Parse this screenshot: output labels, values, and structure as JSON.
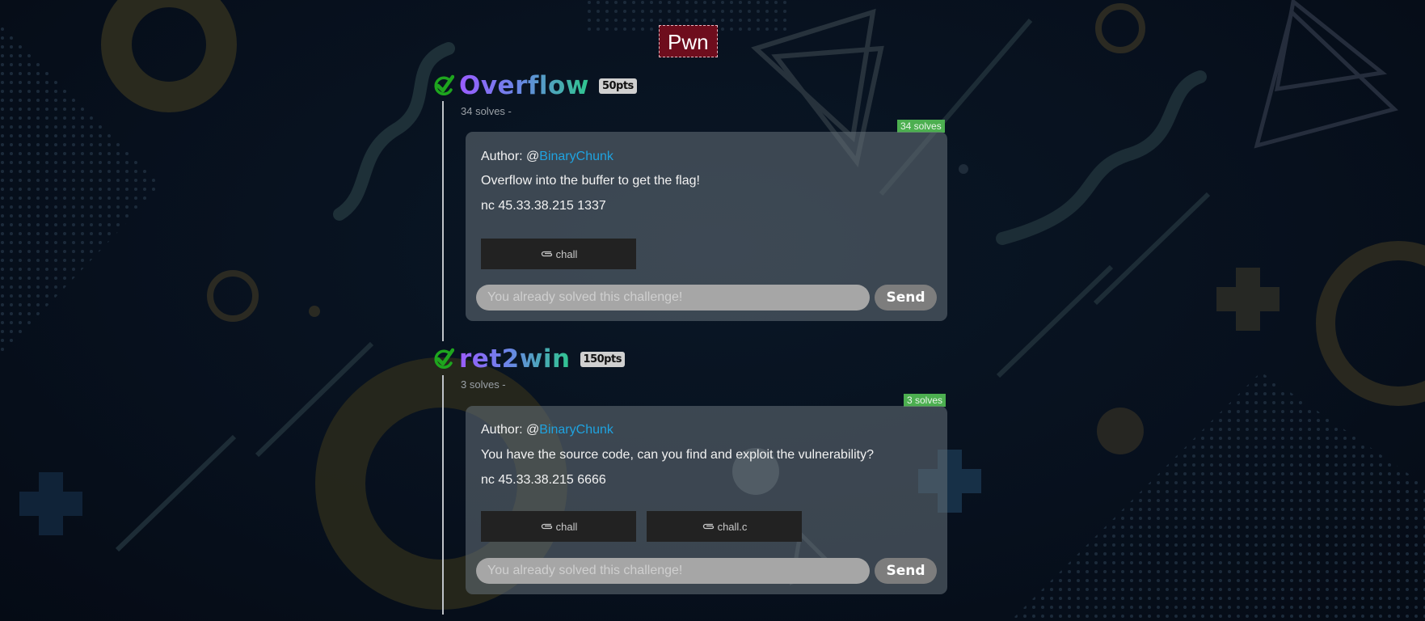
{
  "category": {
    "label": "Pwn"
  },
  "challenges": [
    {
      "title": "Overflow",
      "points": "50pts",
      "solves_line": "34 solves -",
      "solves_tag": "34 solves",
      "author_prefix": "Author: @",
      "author": "BinaryChunk",
      "description": "Overflow into the buffer to get the flag!",
      "connection": "nc 45.33.38.215 1337",
      "files": [
        "chall"
      ],
      "flag_placeholder": "You already solved this challenge!",
      "send_label": "Send",
      "solved": true
    },
    {
      "title": "ret2win",
      "points": "150pts",
      "solves_line": "3 solves -",
      "solves_tag": "3 solves",
      "author_prefix": "Author: @",
      "author": "BinaryChunk",
      "description": "You have the source code, can you find and exploit the vulnerability?",
      "connection": "nc 45.33.38.215 6666",
      "files": [
        "chall",
        "chall.c"
      ],
      "flag_placeholder": "You already solved this challenge!",
      "send_label": "Send",
      "solved": true
    }
  ],
  "colors": {
    "category_bg": "#6e0d1d",
    "check": "#1ea51e",
    "title_gradient": [
      "#9b5cff",
      "#2fc68e"
    ],
    "author_link": "#1fa3e0",
    "solves_tag": "#4caf50"
  },
  "icons": {
    "solved": "check-icon",
    "attachment": "paperclip-icon"
  }
}
